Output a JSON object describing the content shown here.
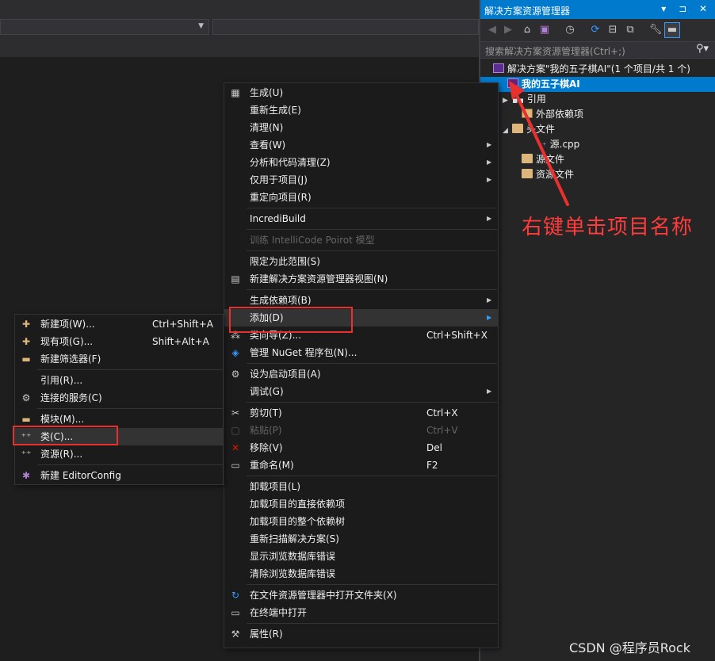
{
  "solution_explorer": {
    "title": "解决方案资源管理器",
    "title_buttons": "▾ ⊐ ✕",
    "search_placeholder": "搜索解决方案资源管理器(Ctrl+;)",
    "tree": {
      "solution": "解决方案\"我的五子棋AI\"(1 个项目/共 1 个)",
      "project": "我的五子棋AI",
      "references": "引用",
      "external_deps": "外部依赖项",
      "header_files": "头文件",
      "source_cpp": "源.cpp",
      "source_files": "源文件",
      "resource_files": "资源文件"
    }
  },
  "annotation": "右键单击项目名称",
  "watermark": "CSDN @程序员Rock",
  "project_menu": [
    {
      "label": "生成(U)",
      "icon": "build-icon"
    },
    {
      "label": "重新生成(E)"
    },
    {
      "label": "清理(N)"
    },
    {
      "label": "查看(W)",
      "submenu": true
    },
    {
      "label": "分析和代码清理(Z)",
      "submenu": true
    },
    {
      "label": "仅用于项目(J)",
      "submenu": true
    },
    {
      "label": "重定向项目(R)"
    },
    {
      "sep": true
    },
    {
      "label": "IncrediBuild",
      "submenu": true
    },
    {
      "sep": true
    },
    {
      "label": "训练 IntelliCode Poirot 模型",
      "disabled": true
    },
    {
      "sep": true
    },
    {
      "label": "限定为此范围(S)"
    },
    {
      "label": "新建解决方案资源管理器视图(N)",
      "icon": "new-view-icon"
    },
    {
      "sep": true
    },
    {
      "label": "生成依赖项(B)",
      "submenu": true
    },
    {
      "label": "添加(D)",
      "submenu": true,
      "highlight": true
    },
    {
      "label": "类向导(Z)...",
      "shortcut": "Ctrl+Shift+X",
      "icon": "class-wizard-icon"
    },
    {
      "label": "管理 NuGet 程序包(N)...",
      "icon": "nuget-icon"
    },
    {
      "sep": true
    },
    {
      "label": "设为启动项目(A)",
      "icon": "gear-icon"
    },
    {
      "label": "调试(G)",
      "submenu": true
    },
    {
      "sep": true
    },
    {
      "label": "剪切(T)",
      "shortcut": "Ctrl+X",
      "icon": "scissors-icon"
    },
    {
      "label": "粘贴(P)",
      "shortcut": "Ctrl+V",
      "icon": "paste-icon",
      "disabled": true
    },
    {
      "label": "移除(V)",
      "shortcut": "Del",
      "icon": "remove-icon"
    },
    {
      "label": "重命名(M)",
      "shortcut": "F2",
      "icon": "rename-icon"
    },
    {
      "sep": true
    },
    {
      "label": "卸载项目(L)"
    },
    {
      "label": "加载项目的直接依赖项"
    },
    {
      "label": "加载项目的整个依赖树"
    },
    {
      "label": "重新扫描解决方案(S)"
    },
    {
      "label": "显示浏览数据库错误"
    },
    {
      "label": "清除浏览数据库错误"
    },
    {
      "sep": true
    },
    {
      "label": "在文件资源管理器中打开文件夹(X)",
      "icon": "open-folder-icon"
    },
    {
      "label": "在终端中打开",
      "icon": "terminal-icon"
    },
    {
      "sep": true
    },
    {
      "label": "属性(R)",
      "icon": "wrench-icon"
    }
  ],
  "add_submenu": [
    {
      "label": "新建项(W)...",
      "shortcut": "Ctrl+Shift+A",
      "icon": "new-item-icon"
    },
    {
      "label": "现有项(G)...",
      "shortcut": "Shift+Alt+A",
      "icon": "existing-item-icon"
    },
    {
      "label": "新建筛选器(F)",
      "icon": "new-filter-icon"
    },
    {
      "sep": true
    },
    {
      "label": "引用(R)..."
    },
    {
      "label": "连接的服务(C)",
      "icon": "connected-service-icon"
    },
    {
      "sep": true
    },
    {
      "label": "模块(M)...",
      "icon": "module-icon"
    },
    {
      "label": "类(C)...",
      "icon": "class-icon",
      "highlight": true
    },
    {
      "label": "资源(R)...",
      "icon": "resource-icon"
    },
    {
      "sep": true
    },
    {
      "label": "新建 EditorConfig",
      "icon": "editorconfig-icon"
    }
  ]
}
